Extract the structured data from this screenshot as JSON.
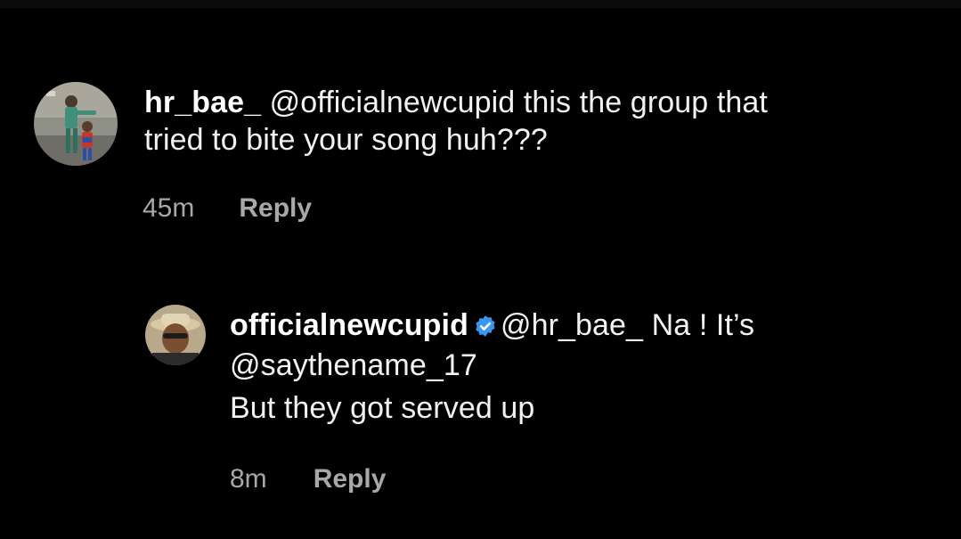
{
  "comment": {
    "username": "hr_bae_",
    "mention": "@officialnewcupid",
    "text_line1": "this the group that",
    "text_line2": "tried to bite your song huh???",
    "time": "45m",
    "reply_label": "Reply"
  },
  "reply": {
    "username": "officialnewcupid",
    "verified": true,
    "mention": "@hr_bae_",
    "text_line1": "Na ! It’s",
    "text_line2": "@saythename_17",
    "text_line3": "But they got served up",
    "time": "8m",
    "reply_label": "Reply"
  },
  "colors": {
    "background": "#000000",
    "text": "#f2f2f2",
    "secondary": "#a8a8a8",
    "verified": "#3897f0"
  }
}
